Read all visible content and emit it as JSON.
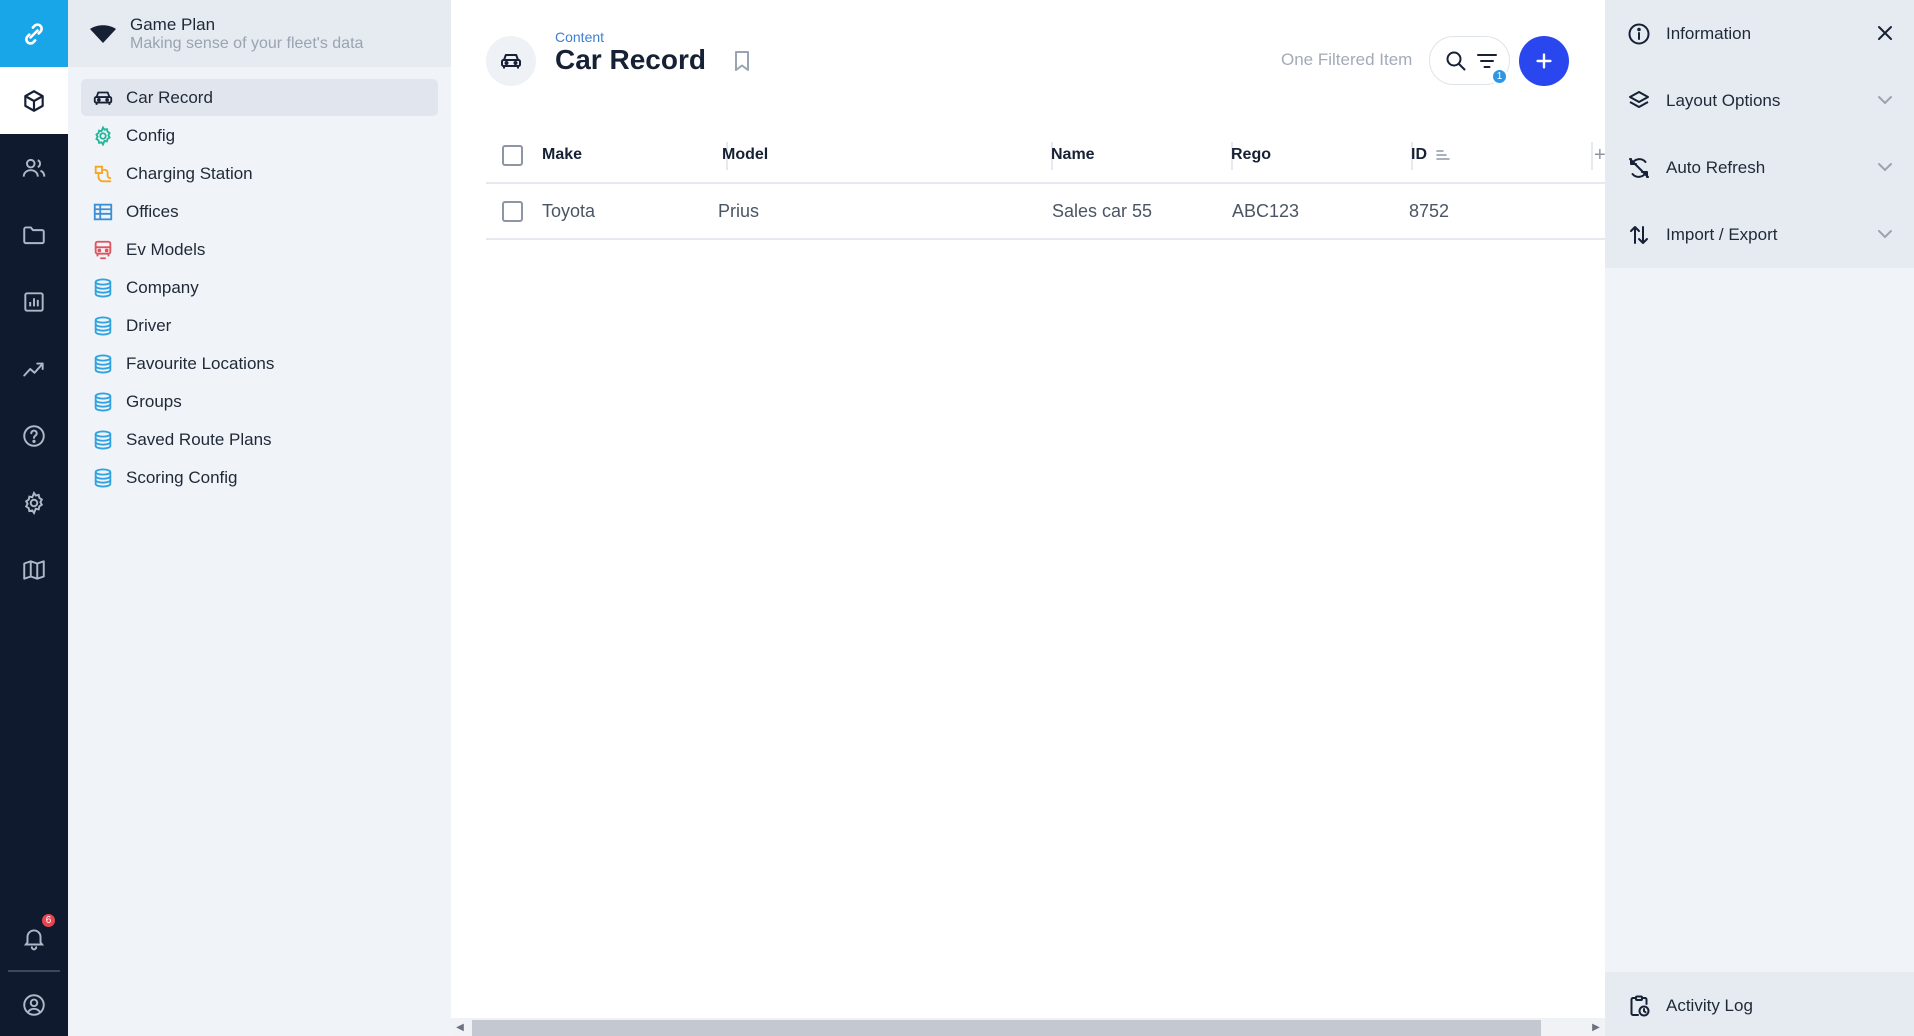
{
  "rail": {
    "brand_color": "#18a6e8",
    "items": [
      "content-icon",
      "users-icon",
      "folder-icon",
      "insights-icon",
      "activity-icon",
      "help-icon",
      "settings-icon",
      "map-icon"
    ],
    "notifications_count": "6"
  },
  "sidebar": {
    "project_name": "Game Plan",
    "project_tagline": "Making sense of your fleet's data",
    "items": [
      {
        "label": "Car Record",
        "icon": "car-icon",
        "active": true
      },
      {
        "label": "Config",
        "icon": "gear-icon"
      },
      {
        "label": "Charging Station",
        "icon": "ev-charger-icon"
      },
      {
        "label": "Offices",
        "icon": "building-icon"
      },
      {
        "label": "Ev Models",
        "icon": "car-outline-icon"
      },
      {
        "label": "Company",
        "icon": "database-icon"
      },
      {
        "label": "Driver",
        "icon": "database-icon"
      },
      {
        "label": "Favourite Locations",
        "icon": "database-icon"
      },
      {
        "label": "Groups",
        "icon": "database-icon"
      },
      {
        "label": "Saved Route Plans",
        "icon": "database-icon"
      },
      {
        "label": "Scoring Config",
        "icon": "database-icon"
      }
    ]
  },
  "header": {
    "breadcrumb": "Content",
    "title": "Car Record",
    "filtered_label": "One Filtered Item",
    "filter_count": "1",
    "accent_color": "#2a47ef"
  },
  "table": {
    "columns": [
      "Make",
      "Model",
      "Name",
      "Rego",
      "ID"
    ],
    "rows": [
      {
        "make": "Toyota",
        "model": "Prius",
        "name": "Sales car 55",
        "rego": "ABC123",
        "id": "8752"
      }
    ]
  },
  "panel": {
    "items": [
      {
        "label": "Information",
        "icon": "info-icon"
      },
      {
        "label": "Layout Options",
        "icon": "layers-icon"
      },
      {
        "label": "Auto Refresh",
        "icon": "refresh-off-icon"
      },
      {
        "label": "Import / Export",
        "icon": "import-export-icon"
      }
    ],
    "activity_log": "Activity Log"
  }
}
